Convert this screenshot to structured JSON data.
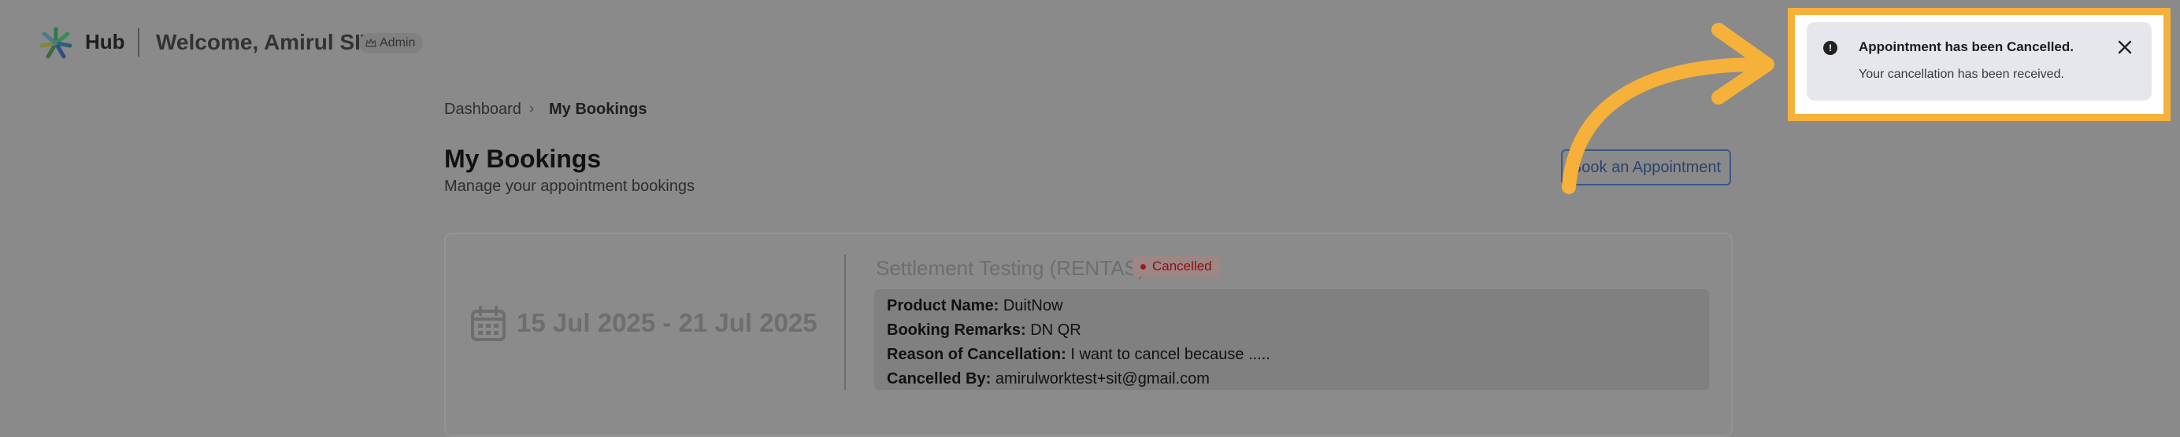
{
  "header": {
    "app_name": "Hub",
    "welcome": "Welcome, Amirul SIT",
    "role_badge": "Admin"
  },
  "breadcrumb": {
    "items": [
      "Dashboard",
      "My Bookings"
    ],
    "separator": "›"
  },
  "page": {
    "title": "My Bookings",
    "subtitle": "Manage your appointment bookings",
    "book_button": "Book an Appointment"
  },
  "booking": {
    "date_range": "15 Jul 2025 - 21 Jul 2025",
    "title": "Settlement Testing (RENTAS)",
    "status": "Cancelled",
    "fields": [
      {
        "label": "Product Name:",
        "value": "DuitNow"
      },
      {
        "label": "Booking Remarks:",
        "value": "DN QR"
      },
      {
        "label": "Reason of Cancellation:",
        "value": "I want to cancel because ....."
      },
      {
        "label": "Cancelled By:",
        "value": "amirulworktest+sit@gmail.com"
      }
    ]
  },
  "toast": {
    "title": "Appointment has been Cancelled.",
    "message": "Your cancellation has been received."
  },
  "colors": {
    "overlay": "#8a8a8a",
    "highlight": "#f6b13a",
    "status": "#a01a1a",
    "button": "#28446d"
  },
  "icons": [
    "logo-icon",
    "crown-icon",
    "calendar-icon",
    "info-icon",
    "close-icon",
    "arrow-annotation-icon"
  ]
}
